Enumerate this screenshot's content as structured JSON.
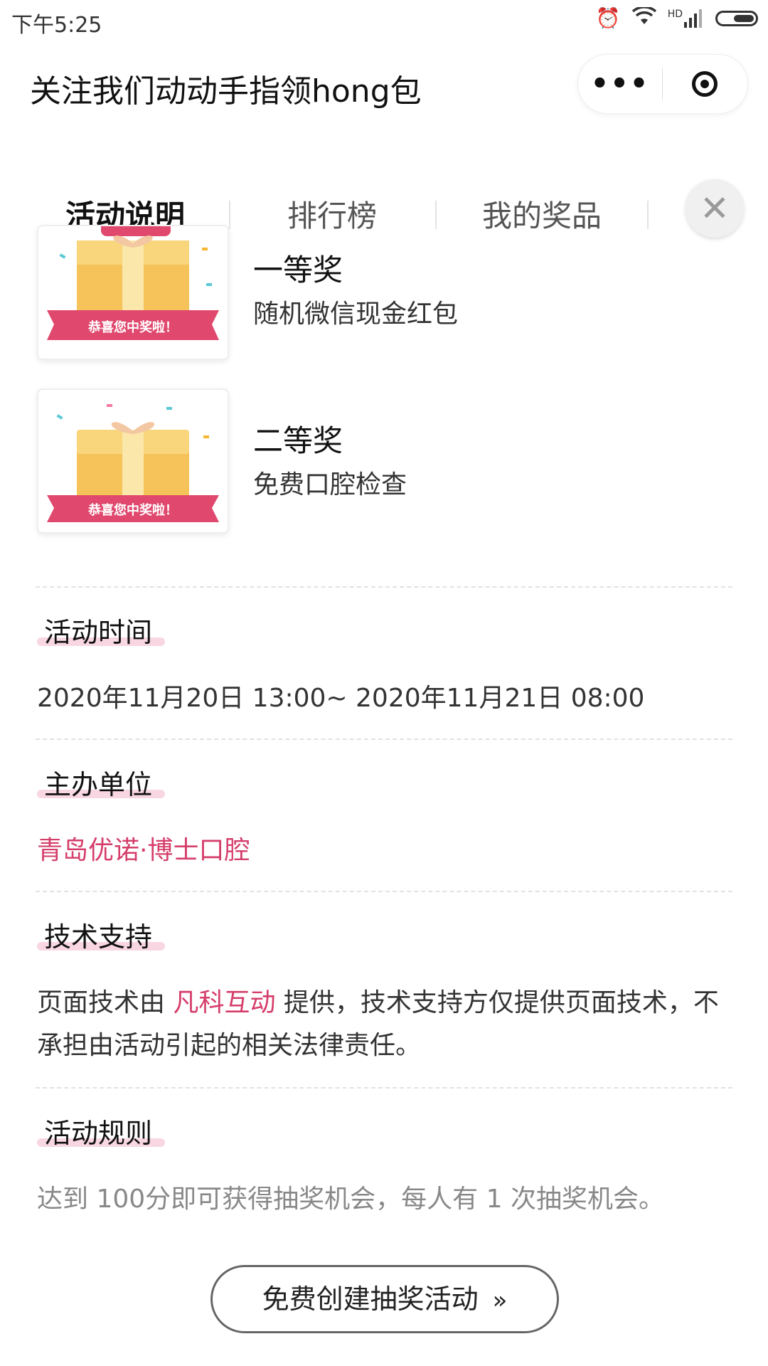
{
  "status_bar": {
    "time": "下午5:25",
    "hd_label": "HD"
  },
  "nav": {
    "title": "关注我们动动手指领hong包",
    "more_icon": "more-icon",
    "target_icon": "target-icon"
  },
  "tabs": [
    {
      "label": "活动说明",
      "active": true
    },
    {
      "label": "排行榜",
      "active": false
    },
    {
      "label": "我的奖品",
      "active": false
    }
  ],
  "close_symbol": "✕",
  "prizes": [
    {
      "name": "一等奖",
      "desc": "随机微信现金红包",
      "banner": "恭喜您中奖啦！"
    },
    {
      "name": "二等奖",
      "desc": "免费口腔检查",
      "banner": "恭喜您中奖啦！"
    }
  ],
  "sections": {
    "time": {
      "title": "活动时间",
      "value": "2020年11月20日 13:00~ 2020年11月21日 08:00"
    },
    "organizer": {
      "title": "主办单位",
      "value": "青岛优诺·博士口腔"
    },
    "tech": {
      "title": "技术支持",
      "prefix": "页面技术由 ",
      "link": "凡科互动",
      "suffix": " 提供，技术支持方仅提供页面技术，不承担由活动引起的相关法律责任。"
    },
    "rules": {
      "title": "活动规则",
      "text": "达到 100分即可获得抽奖机会，每人有 1 次抽奖机会。"
    }
  },
  "cta": {
    "label": "免费创建抽奖活动",
    "arrow": "»"
  },
  "colors": {
    "accent": "#d53d6a",
    "highlight": "#f8d7e2"
  }
}
